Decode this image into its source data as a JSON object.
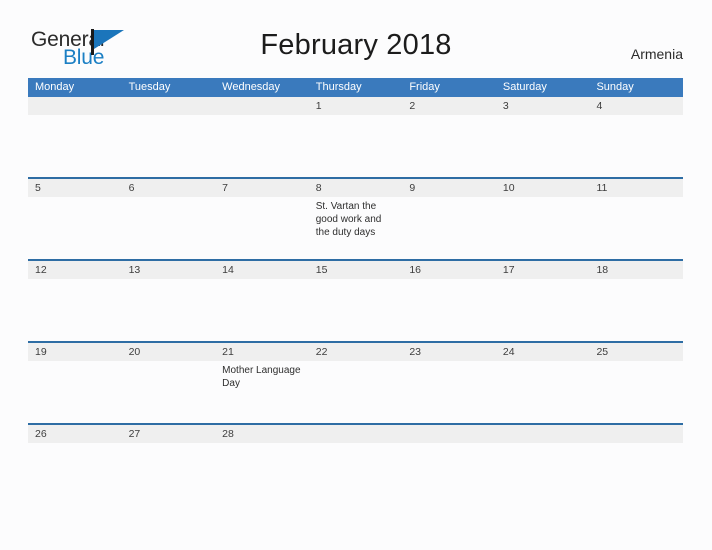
{
  "brand": {
    "name_part1": "General",
    "name_part2": "Blue",
    "flag_icon": "flag-icon"
  },
  "header": {
    "title": "February 2018",
    "country": "Armenia"
  },
  "calendar": {
    "weekdays": [
      "Monday",
      "Tuesday",
      "Wednesday",
      "Thursday",
      "Friday",
      "Saturday",
      "Sunday"
    ],
    "colors": {
      "header_blue": "#3a7abd",
      "row_divider_blue": "#2e6da4",
      "date_band_gray": "#efefef",
      "brand_blue": "#1b7fc4",
      "page_background": "#fcfcfd"
    },
    "weeks": [
      [
        {
          "date": "",
          "event": ""
        },
        {
          "date": "",
          "event": ""
        },
        {
          "date": "",
          "event": ""
        },
        {
          "date": "1",
          "event": ""
        },
        {
          "date": "2",
          "event": ""
        },
        {
          "date": "3",
          "event": ""
        },
        {
          "date": "4",
          "event": ""
        }
      ],
      [
        {
          "date": "5",
          "event": ""
        },
        {
          "date": "6",
          "event": ""
        },
        {
          "date": "7",
          "event": ""
        },
        {
          "date": "8",
          "event": "St. Vartan the good work and the duty days"
        },
        {
          "date": "9",
          "event": ""
        },
        {
          "date": "10",
          "event": ""
        },
        {
          "date": "11",
          "event": ""
        }
      ],
      [
        {
          "date": "12",
          "event": ""
        },
        {
          "date": "13",
          "event": ""
        },
        {
          "date": "14",
          "event": ""
        },
        {
          "date": "15",
          "event": ""
        },
        {
          "date": "16",
          "event": ""
        },
        {
          "date": "17",
          "event": ""
        },
        {
          "date": "18",
          "event": ""
        }
      ],
      [
        {
          "date": "19",
          "event": ""
        },
        {
          "date": "20",
          "event": ""
        },
        {
          "date": "21",
          "event": "Mother Language Day"
        },
        {
          "date": "22",
          "event": ""
        },
        {
          "date": "23",
          "event": ""
        },
        {
          "date": "24",
          "event": ""
        },
        {
          "date": "25",
          "event": ""
        }
      ],
      [
        {
          "date": "26",
          "event": ""
        },
        {
          "date": "27",
          "event": ""
        },
        {
          "date": "28",
          "event": ""
        },
        {
          "date": "",
          "event": ""
        },
        {
          "date": "",
          "event": ""
        },
        {
          "date": "",
          "event": ""
        },
        {
          "date": "",
          "event": ""
        }
      ]
    ]
  }
}
